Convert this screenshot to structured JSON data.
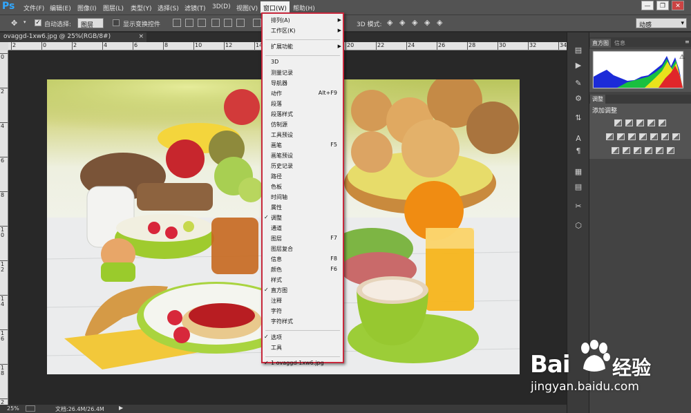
{
  "app": {
    "logo": "Ps"
  },
  "menubar": {
    "items": [
      "文件(F)",
      "编辑(E)",
      "图像(I)",
      "图层(L)",
      "类型(Y)",
      "选择(S)",
      "滤镜(T)",
      "3D(D)",
      "视图(V)",
      "窗口(W)",
      "帮助(H)"
    ],
    "active_index": 9,
    "window_controls": {
      "minimize": "—",
      "restore": "❐",
      "close": "✕"
    }
  },
  "options_bar": {
    "auto_select_label": "自动选择:",
    "auto_select_checked": true,
    "auto_select_value": "图层",
    "show_transform_label": "显示变换控件",
    "show_transform_checked": false,
    "mode_3d_label": "3D 模式:",
    "workspace_value": "动感"
  },
  "document": {
    "tab_title": "ovaggd-1xw6.jpg @ 25%(RGB/8#)",
    "tab_close": "×"
  },
  "rulers": {
    "top": [
      "2",
      "0",
      "2",
      "4",
      "6",
      "8",
      "10",
      "12",
      "14",
      "16",
      "18",
      "20",
      "22",
      "24",
      "26",
      "28",
      "30",
      "32",
      "34"
    ],
    "left": [
      "0",
      "2",
      "4",
      "6",
      "8",
      "1\n0",
      "1\n2",
      "1\n4",
      "1\n6",
      "1\n8",
      "2\n0"
    ]
  },
  "status_bar": {
    "zoom": "25%",
    "doc_info": "文档:26.4M/26.4M"
  },
  "panels": {
    "histogram_tabs": [
      "直方图",
      "信息"
    ],
    "adjust_tab": "调整",
    "adjust_title": "添加调整"
  },
  "window_menu": {
    "items": [
      {
        "label": "排列(A)",
        "submenu": true
      },
      {
        "label": "工作区(K)",
        "submenu": true
      },
      {
        "sep": true
      },
      {
        "label": "扩展功能",
        "submenu": true
      },
      {
        "sep": true
      },
      {
        "label": "3D"
      },
      {
        "label": "测量记录"
      },
      {
        "label": "导航器"
      },
      {
        "label": "动作",
        "shortcut": "Alt+F9"
      },
      {
        "label": "段落"
      },
      {
        "label": "段落样式"
      },
      {
        "label": "仿制源"
      },
      {
        "label": "工具预设"
      },
      {
        "label": "画笔",
        "shortcut": "F5"
      },
      {
        "label": "画笔预设"
      },
      {
        "label": "历史记录"
      },
      {
        "label": "路径"
      },
      {
        "label": "色板"
      },
      {
        "label": "时间轴"
      },
      {
        "label": "属性"
      },
      {
        "label": "调整",
        "checked": true
      },
      {
        "label": "通道"
      },
      {
        "label": "图层",
        "shortcut": "F7"
      },
      {
        "label": "图层复合"
      },
      {
        "label": "信息",
        "shortcut": "F8"
      },
      {
        "label": "颜色",
        "shortcut": "F6"
      },
      {
        "label": "样式"
      },
      {
        "label": "直方图",
        "checked": true
      },
      {
        "label": "注释"
      },
      {
        "label": "字符"
      },
      {
        "label": "字符样式"
      },
      {
        "sep": true
      },
      {
        "label": "选项",
        "checked": true
      },
      {
        "label": "工具"
      },
      {
        "sep": true
      },
      {
        "label": "1 ovaggd-1xw6.jpg",
        "checked": true
      }
    ]
  },
  "watermark": {
    "brand": "Bai",
    "brand_end": "经验",
    "url": "jingyan.baidu.com"
  },
  "colors": {
    "menu_highlight_border": "#c8283c",
    "chrome": "#535353",
    "ps_blue": "#31a8ff"
  }
}
